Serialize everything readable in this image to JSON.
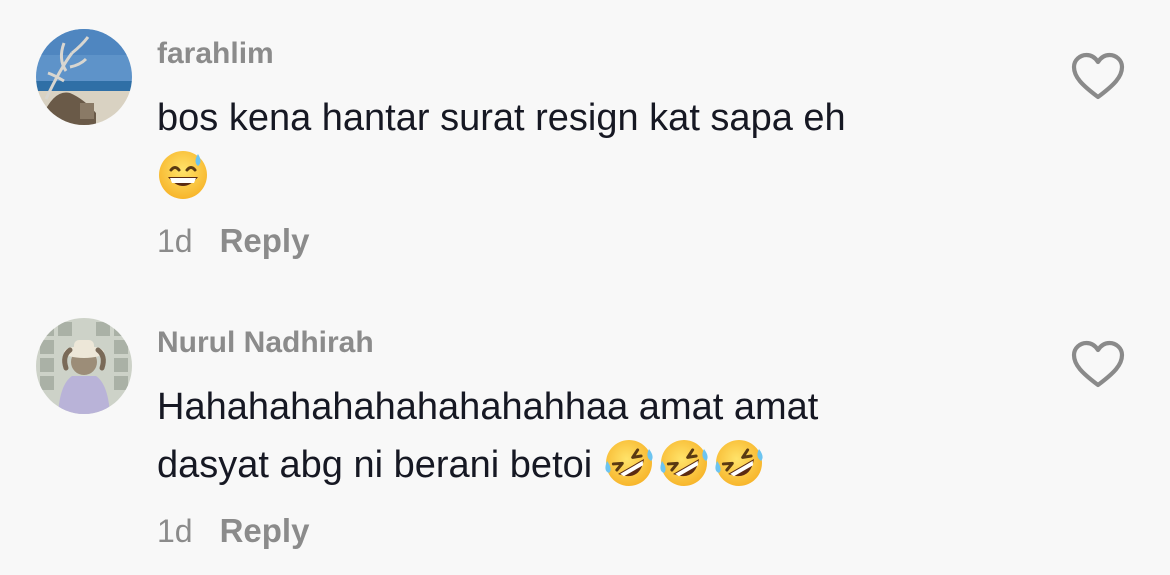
{
  "comments": [
    {
      "username": "farahlim",
      "lines": [
        "bos kena hantar surat resign kat sapa eh",
        ""
      ],
      "emojis": [
        "grinning-face-with-sweat"
      ],
      "time": "1d",
      "reply_label": "Reply",
      "avatar": "beach-driftwood-photo",
      "like_icon": "heart-outline-icon"
    },
    {
      "username": "Nurul Nadhirah",
      "lines": [
        "Hahahahahahahahahahhaa amat amat",
        "dasyat abg ni berani betoi"
      ],
      "emojis": [
        "rolling-on-the-floor-laughing",
        "rolling-on-the-floor-laughing",
        "rolling-on-the-floor-laughing"
      ],
      "time": "1d",
      "reply_label": "Reply",
      "avatar": "person-hat-photo",
      "like_icon": "heart-outline-icon"
    }
  ],
  "colors": {
    "background": "#f8f8f8",
    "text_primary": "#161823",
    "text_secondary": "#8b8b8b",
    "heart_stroke": "#8a8a8a"
  }
}
